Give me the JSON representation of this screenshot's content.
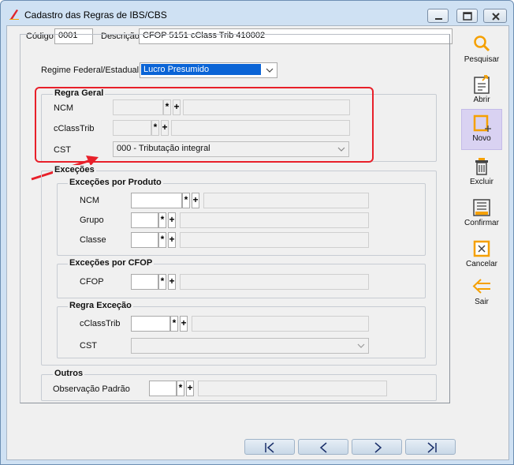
{
  "window": {
    "title": "Cadastro das Regras de IBS/CBS"
  },
  "header": {
    "codigo_label": "Código",
    "codigo_value": "0001",
    "descricao_label": "Descrição",
    "descricao_value": "CFOP 5151 cClass Trib 410002"
  },
  "regime": {
    "label": "Regime Federal/Estadual",
    "value": "Lucro Presumido"
  },
  "regra_geral": {
    "title": "Regra Geral",
    "ncm_label": "NCM",
    "cclasstrib_label": "cClassTrib",
    "cst_label": "CST",
    "cst_value": "000 - Tributação integral"
  },
  "excecoes": {
    "title": "Exceções",
    "por_produto": {
      "title": "Exceções por Produto",
      "ncm_label": "NCM",
      "grupo_label": "Grupo",
      "classe_label": "Classe"
    },
    "por_cfop": {
      "title": "Exceções por CFOP",
      "cfop_label": "CFOP"
    },
    "regra_excecao": {
      "title": "Regra Exceção",
      "cclasstrib_label": "cClassTrib",
      "cst_label": "CST"
    }
  },
  "outros": {
    "title": "Outros",
    "obs_label": "Observação Padrão"
  },
  "search_symbols": {
    "star": "*",
    "plus": "+"
  },
  "toolbar": {
    "pesquisar": "Pesquisar",
    "abrir": "Abrir",
    "novo": "Novo",
    "excluir": "Excluir",
    "confirmar": "Confirmar",
    "cancelar": "Cancelar",
    "sair": "Sair"
  },
  "colors": {
    "accent": "#f5a000",
    "highlight_box": "#e8202a",
    "selection": "#0a64d6"
  }
}
